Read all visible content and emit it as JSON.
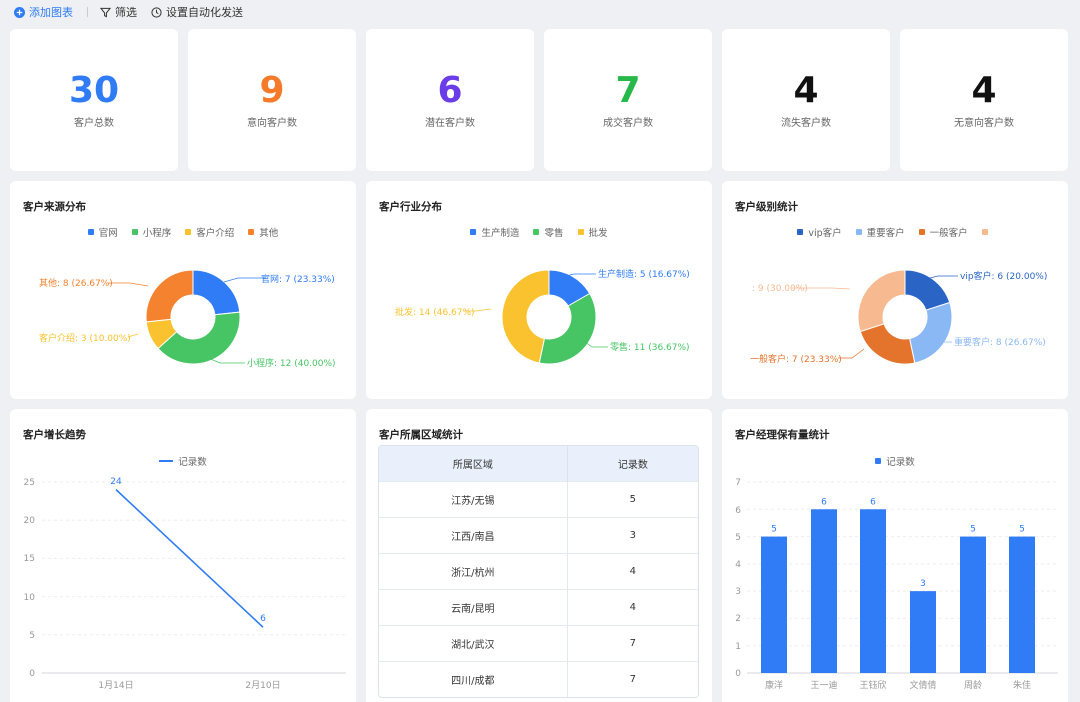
{
  "toolbar": {
    "add_chart": "添加图表",
    "filter": "筛选",
    "auto_send": "设置自动化发送"
  },
  "stats": [
    {
      "value": "30",
      "label": "客户总数",
      "color": "#2f7cf6"
    },
    {
      "value": "9",
      "label": "意向客户数",
      "color": "#f57b2a"
    },
    {
      "value": "6",
      "label": "潜在客户数",
      "color": "#6a3de8"
    },
    {
      "value": "7",
      "label": "成交客户数",
      "color": "#27b84a"
    },
    {
      "value": "4",
      "label": "流失客户数",
      "color": "#111111"
    },
    {
      "value": "4",
      "label": "无意向客户数",
      "color": "#111111"
    }
  ],
  "source_chart": {
    "title": "客户来源分布",
    "legend": [
      "官网",
      "小程序",
      "客户介绍",
      "其他"
    ],
    "labels": [
      "官网: 7 (23.33%)",
      "小程序: 12 (40.00%)",
      "客户介绍: 3 (10.00%)",
      "其他: 8 (26.67%)"
    ]
  },
  "industry_chart": {
    "title": "客户行业分布",
    "legend": [
      "生产制造",
      "零售",
      "批发"
    ],
    "labels": [
      "生产制造: 5 (16.67%)",
      "零售: 11 (36.67%)",
      "批发: 14 (46.67%)"
    ]
  },
  "level_chart": {
    "title": "客户级别统计",
    "legend": [
      "vip客户",
      "重要客户",
      "一般客户",
      ""
    ],
    "labels": [
      "vip客户: 6 (20.00%)",
      "重要客户: 8 (26.67%)",
      "一般客户: 7 (23.33%)",
      ": 9 (30.00%)"
    ]
  },
  "trend_chart": {
    "title": "客户增长趋势",
    "legend": "记录数",
    "yticks": [
      "0",
      "5",
      "10",
      "15",
      "20",
      "25"
    ],
    "xticks": [
      "1月14日",
      "2月10日"
    ],
    "point_labels": [
      "24",
      "6"
    ]
  },
  "region_table": {
    "title": "客户所属区域统计",
    "headers": [
      "所属区域",
      "记录数"
    ],
    "rows": [
      [
        "江苏/无锡",
        "5"
      ],
      [
        "江西/南昌",
        "3"
      ],
      [
        "浙江/杭州",
        "4"
      ],
      [
        "云南/昆明",
        "4"
      ],
      [
        "湖北/武汉",
        "7"
      ],
      [
        "四川/成都",
        "7"
      ]
    ]
  },
  "manager_chart": {
    "title": "客户经理保有量统计",
    "legend": "记录数",
    "yticks": [
      "0",
      "1",
      "2",
      "3",
      "4",
      "5",
      "6",
      "7"
    ],
    "names": [
      "康洋",
      "王一迪",
      "王钰欣",
      "文倩倩",
      "周龄",
      "朱佳"
    ],
    "value_labels": [
      "5",
      "6",
      "6",
      "3",
      "5",
      "5"
    ]
  },
  "colors": {
    "blue": "#2f7cf6",
    "green": "#47c564",
    "yellow": "#f9c22e",
    "orange": "#f5822f",
    "vip": "#2a64c5",
    "important": "#8ab8f5",
    "normal": "#e4742c",
    "other": "#f7b98f"
  },
  "chart_data": [
    {
      "type": "pie",
      "title": "客户来源分布",
      "categories": [
        "官网",
        "小程序",
        "客户介绍",
        "其他"
      ],
      "values": [
        7,
        12,
        3,
        8
      ]
    },
    {
      "type": "pie",
      "title": "客户行业分布",
      "categories": [
        "生产制造",
        "零售",
        "批发"
      ],
      "values": [
        5,
        11,
        14
      ]
    },
    {
      "type": "pie",
      "title": "客户级别统计",
      "categories": [
        "vip客户",
        "重要客户",
        "一般客户",
        ""
      ],
      "values": [
        6,
        8,
        7,
        9
      ]
    },
    {
      "type": "line",
      "title": "客户增长趋势",
      "categories": [
        "1月14日",
        "2月10日"
      ],
      "series": [
        {
          "name": "记录数",
          "values": [
            24,
            6
          ]
        }
      ],
      "ylim": [
        0,
        25
      ]
    },
    {
      "type": "table",
      "title": "客户所属区域统计",
      "columns": [
        "所属区域",
        "记录数"
      ],
      "rows": [
        [
          "江苏/无锡",
          5
        ],
        [
          "江西/南昌",
          3
        ],
        [
          "浙江/杭州",
          4
        ],
        [
          "云南/昆明",
          4
        ],
        [
          "湖北/武汉",
          7
        ],
        [
          "四川/成都",
          7
        ]
      ]
    },
    {
      "type": "bar",
      "title": "客户经理保有量统计",
      "categories": [
        "康洋",
        "王一迪",
        "王钰欣",
        "文倩倩",
        "周龄",
        "朱佳"
      ],
      "series": [
        {
          "name": "记录数",
          "values": [
            5,
            6,
            6,
            3,
            5,
            5
          ]
        }
      ],
      "ylim": [
        0,
        7
      ]
    }
  ]
}
